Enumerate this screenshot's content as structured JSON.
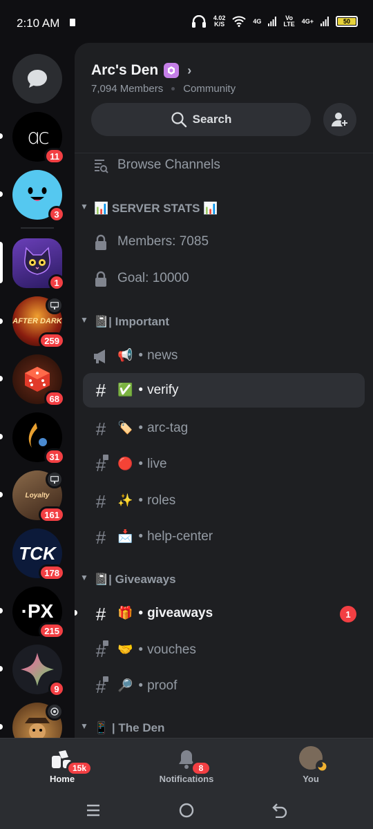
{
  "status_bar": {
    "time": "2:10 AM",
    "speed_value": "4.02",
    "speed_unit": "K/S",
    "net1": "4G",
    "volte_top": "Vo",
    "volte_bottom": "LTE",
    "net2": "4G+",
    "battery": "50"
  },
  "server_rail": {
    "servers": [
      {
        "name": "ac",
        "badge": "11",
        "color": "#000000"
      },
      {
        "name": "smiley",
        "badge": "3",
        "color": "#55c8f0"
      },
      {
        "name": "cat",
        "badge": "1",
        "color": "#6a3fb8"
      },
      {
        "name": "AFTER DARK",
        "badge": "259",
        "color": "#8a1d0f"
      },
      {
        "name": "dice",
        "badge": "68",
        "color": "#3b1a10"
      },
      {
        "name": "flame",
        "badge": "31",
        "color": "#000000"
      },
      {
        "name": "Loyalty",
        "badge": "161",
        "color": "#5a3a2a"
      },
      {
        "name": "TCK",
        "badge": "178",
        "color": "#0c1a3a"
      },
      {
        "name": "·PX",
        "badge": "215",
        "color": "#000000"
      },
      {
        "name": "star",
        "badge": "9",
        "color": "#1b1d24"
      },
      {
        "name": "detective",
        "badge": "",
        "color": "#6b4a2a"
      }
    ]
  },
  "header": {
    "server_name": "Arc's Den",
    "members": "7,094 Members",
    "community": "Community",
    "search_label": "Search"
  },
  "channels": {
    "browse": "Browse Channels",
    "cat_stats": "📊 SERVER STATS 📊",
    "members_stat": "Members: 7085",
    "goal_stat": "Goal: 10000",
    "cat_important": "📓| Important",
    "news": {
      "emoji": "📢",
      "name": "news"
    },
    "verify": {
      "emoji": "✅",
      "name": "verify"
    },
    "arc_tag": {
      "emoji": "🏷️",
      "name": "arc-tag"
    },
    "live": {
      "emoji": "🔴",
      "name": "live"
    },
    "roles": {
      "emoji": "✨",
      "name": "roles"
    },
    "help": {
      "emoji": "📩",
      "name": "help-center"
    },
    "cat_giveaways": "📓| Giveaways",
    "giveaways": {
      "emoji": "🎁",
      "name": "giveaways",
      "mentions": "1"
    },
    "vouches": {
      "emoji": "🤝",
      "name": "vouches"
    },
    "proof": {
      "emoji": "🔎",
      "name": "proof"
    },
    "cat_den": "📱 | The Den",
    "bullet": "•"
  },
  "bottom_nav": {
    "home": "Home",
    "home_badge": "15k",
    "notifications": "Notifications",
    "notif_badge": "8",
    "you": "You"
  }
}
